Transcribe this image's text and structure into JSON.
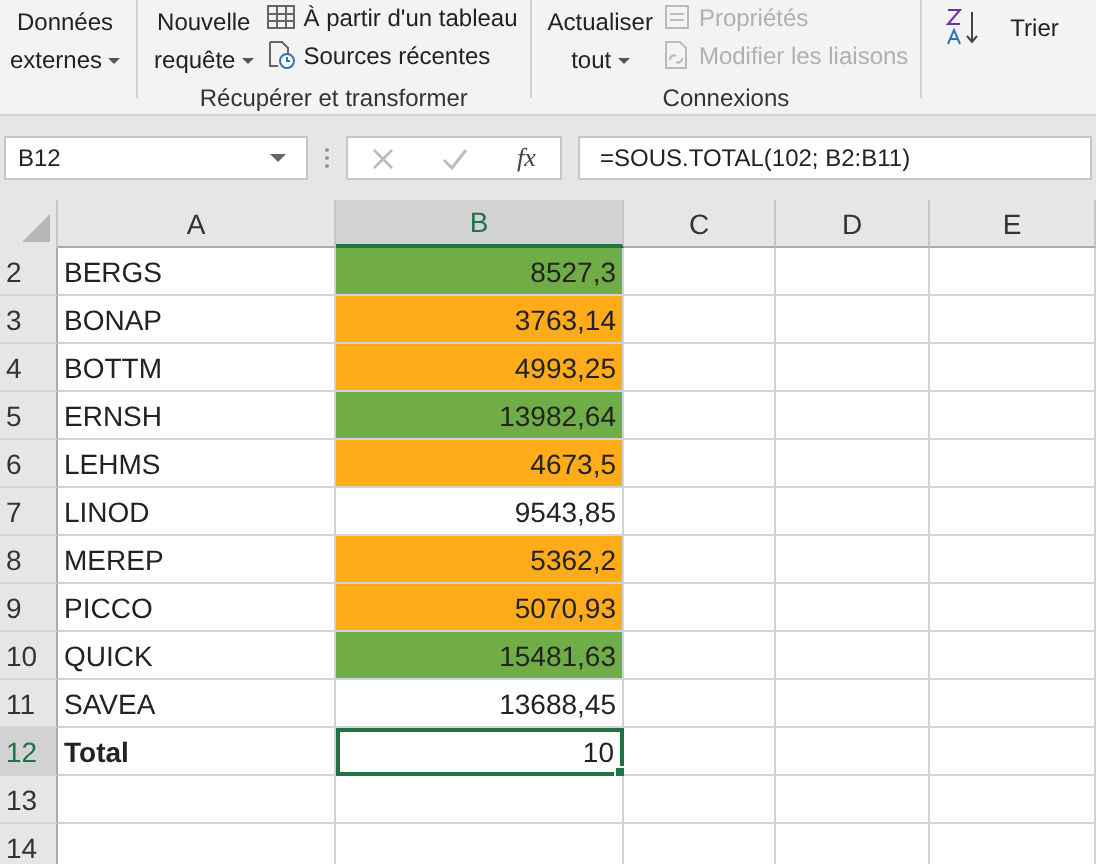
{
  "ribbon": {
    "groups": [
      {
        "large": [
          {
            "text": "Données",
            "text2": "externes",
            "dropdown": true
          }
        ]
      },
      {
        "label": "Récupérer et transformer",
        "large": [
          {
            "text": "Nouvelle",
            "text2": "requête",
            "dropdown": true
          }
        ],
        "small": [
          {
            "text": "À partir d'un tableau",
            "disabled": false
          },
          {
            "text": "Sources récentes",
            "disabled": false
          }
        ]
      },
      {
        "label": "Connexions",
        "large": [
          {
            "text": "Actualiser",
            "text2": "tout",
            "dropdown": true
          }
        ],
        "small": [
          {
            "text": "Propriétés",
            "disabled": true
          },
          {
            "text": "Modifier les liaisons",
            "disabled": true
          }
        ]
      },
      {
        "small": [
          {
            "text": "Trier",
            "disabled": false
          }
        ]
      }
    ]
  },
  "formula_bar": {
    "name_box": "B12",
    "fx": "fx",
    "formula": "=SOUS.TOTAL(102; B2:B11)"
  },
  "columns": [
    {
      "label": "A",
      "selected": false
    },
    {
      "label": "B",
      "selected": true
    },
    {
      "label": "C",
      "selected": false
    },
    {
      "label": "D",
      "selected": false
    },
    {
      "label": "E",
      "selected": false
    }
  ],
  "rows": [
    {
      "number": "2",
      "name": "BERGS",
      "value": "8527,3",
      "color": "#70ad47",
      "bold": false,
      "selected": false
    },
    {
      "number": "3",
      "name": "BONAP",
      "value": "3763,14",
      "color": "#ffab1a",
      "bold": false,
      "selected": false
    },
    {
      "number": "4",
      "name": "BOTTM",
      "value": "4993,25",
      "color": "#ffab1a",
      "bold": false,
      "selected": false
    },
    {
      "number": "5",
      "name": "ERNSH",
      "value": "13982,64",
      "color": "#70ad47",
      "bold": false,
      "selected": false
    },
    {
      "number": "6",
      "name": "LEHMS",
      "value": "4673,5",
      "color": "#ffab1a",
      "bold": false,
      "selected": false
    },
    {
      "number": "7",
      "name": "LINOD",
      "value": "9543,85",
      "bold": false,
      "selected": false
    },
    {
      "number": "8",
      "name": "MEREP",
      "value": "5362,2",
      "color": "#ffab1a",
      "bold": false,
      "selected": false
    },
    {
      "number": "9",
      "name": "PICCO",
      "value": "5070,93",
      "color": "#ffab1a",
      "bold": false,
      "selected": false
    },
    {
      "number": "10",
      "name": "QUICK",
      "value": "15481,63",
      "color": "#70ad47",
      "bold": false,
      "selected": false
    },
    {
      "number": "11",
      "name": "SAVEA",
      "value": "13688,45",
      "bold": false,
      "selected": false
    },
    {
      "number": "12",
      "name": "Total",
      "value": "10",
      "bold": true,
      "selected": true
    },
    {
      "number": "13",
      "selected": false
    },
    {
      "number": "14",
      "selected": false
    }
  ]
}
